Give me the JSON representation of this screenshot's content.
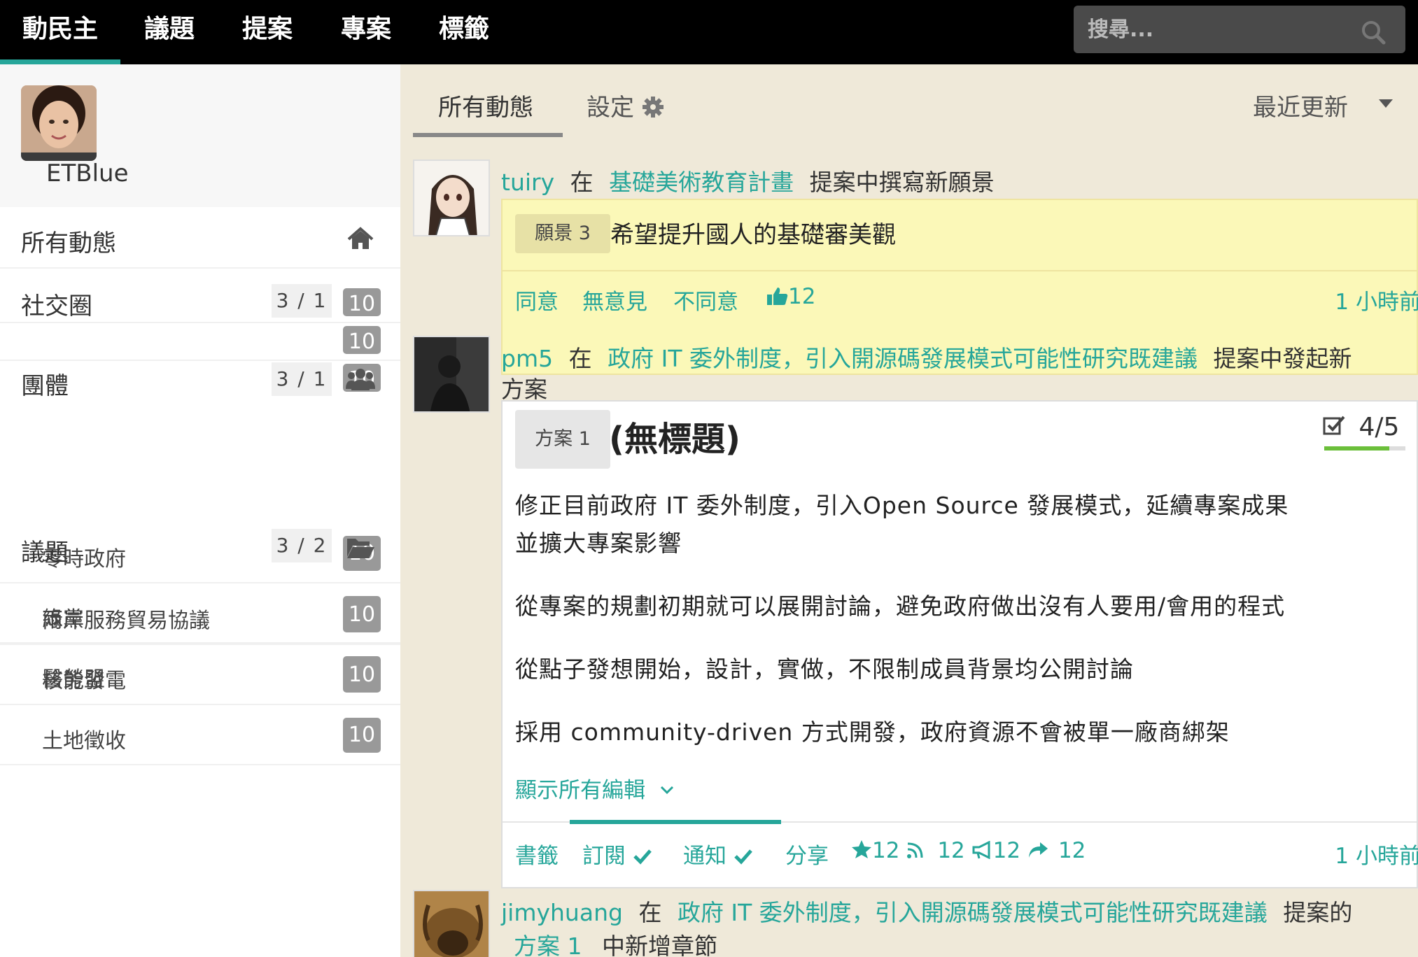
{
  "topnav": {
    "brand": "動民主",
    "items": [
      "議題",
      "提案",
      "專案",
      "標籤"
    ],
    "search_placeholder": "搜尋..."
  },
  "sidebar": {
    "username": "ETBlue",
    "all_activity": "所有動態",
    "social": {
      "label": "社交圈",
      "count": "3 / 1",
      "badges": [
        "10",
        "10",
        "10"
      ]
    },
    "groups": {
      "label": "團體",
      "count": "3 / 1",
      "items": [
        {
          "label": "零時政府",
          "badge": "10"
        },
        {
          "label": "綠黨",
          "badge": "10"
        },
        {
          "label": "醫勞盟",
          "badge": "10"
        }
      ]
    },
    "issues": {
      "label": "議題",
      "count": "3 / 2",
      "items": [
        {
          "label": "兩岸服務貿易協議",
          "badge": "10"
        },
        {
          "label": "核能發電",
          "badge": "10"
        },
        {
          "label": "土地徵收",
          "badge": "10"
        }
      ]
    }
  },
  "main": {
    "tab_all": "所有動態",
    "tab_settings": "設定",
    "sort": "最近更新",
    "feed": [
      {
        "user": "tuiry",
        "prep": "在",
        "target": "基礎美術教育計畫",
        "action": "提案中撰寫新願景",
        "tag": "願景 3",
        "content": "希望提升國人的基礎審美觀",
        "buttons": [
          "同意",
          "無意見",
          "不同意"
        ],
        "likes": "12",
        "time": "1 小時前"
      },
      {
        "user": "pm5",
        "prep": "在",
        "target": "政府 IT 委外制度，引入開源碼發展模式可能性研究既建議",
        "action_1": "提案中發起新",
        "action_2": "方案",
        "tag": "方案 1",
        "title": "(無標題)",
        "score": "4/5",
        "paragraphs": [
          "修正目前政府 IT 委外制度，引入Open Source 發展模式，延續專案成果",
          "並擴大專案影響",
          "從專案的規劃初期就可以展開討論，避免政府做出沒有人要用/會用的程式",
          "從點子發想開始，設計，實做，不限制成員背景均公開討論",
          "採用 community-driven 方式開發，政府資源不會被單一廠商綁架"
        ],
        "show_all": "顯示所有編輯",
        "bookmark": "書籤",
        "subscribe": "訂閱",
        "notify": "通知",
        "share": "分享",
        "stars": "12",
        "rss": "12",
        "announce": "12",
        "shares": "12",
        "time": "1 小時前"
      },
      {
        "user": "jimyhuang",
        "prep": "在",
        "target": "政府 IT 委外制度，引入開源碼發展模式可能性研究既建議",
        "action": "提案的",
        "target_2": "方案 1",
        "action_2": "中新增章節"
      }
    ]
  }
}
